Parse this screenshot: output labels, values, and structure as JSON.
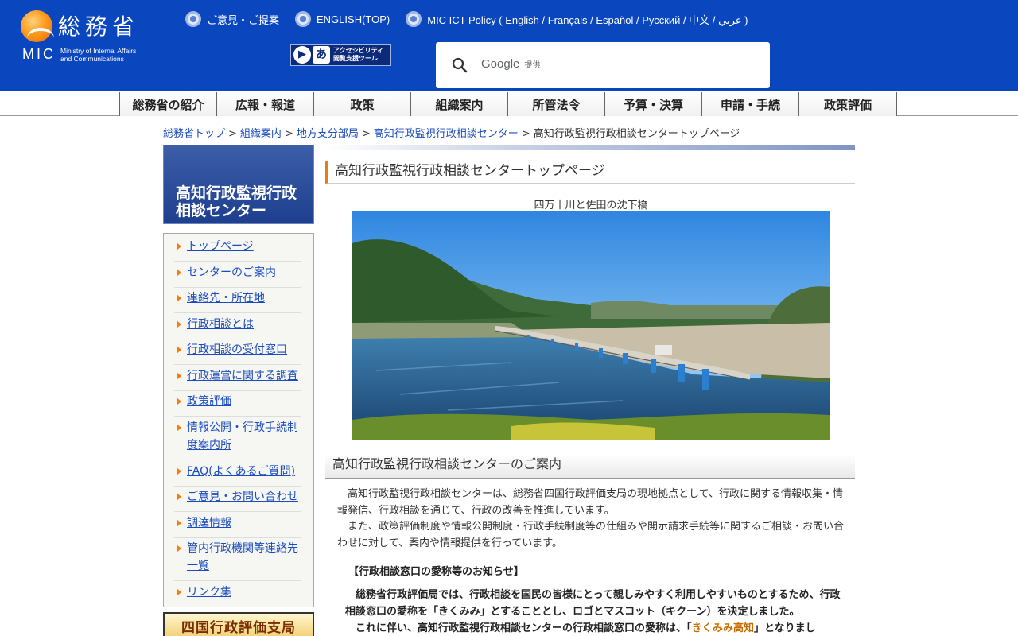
{
  "header": {
    "logo_kanji": "総務省",
    "logo_abbr": "MIC",
    "logo_english_1": "Ministry of Internal Affairs",
    "logo_english_2": "and Communications",
    "top_links": [
      {
        "label": "ご意見・ご提案"
      },
      {
        "label": "ENGLISH(TOP)"
      },
      {
        "label": "MIC ICT Policy ( English / Français / Español / Русский / 中文 / عربي )"
      }
    ],
    "accessibility_tool_label_1": "アクセシビリティ",
    "accessibility_tool_label_2": "閲覧支援ツール",
    "search": {
      "brand": "Google",
      "suffix": "提供"
    }
  },
  "global_nav": [
    {
      "label": "総務省の紹介"
    },
    {
      "label": "広報・報道"
    },
    {
      "label": "政策"
    },
    {
      "label": "組織案内"
    },
    {
      "label": "所管法令"
    },
    {
      "label": "予算・決算"
    },
    {
      "label": "申請・手続"
    },
    {
      "label": "政策評価"
    }
  ],
  "breadcrumb": {
    "links": [
      "総務省トップ",
      "組織案内",
      "地方支分部局",
      "高知行政監視行政相談センター"
    ],
    "separator": ">",
    "current": "高知行政監視行政相談センタートップページ"
  },
  "sidebar": {
    "title_line1": "高知行政監視行政",
    "title_line2": "相談センター",
    "items": [
      {
        "label": "トップページ"
      },
      {
        "label": "センターのご案内"
      },
      {
        "label": "連絡先・所在地"
      },
      {
        "label": "行政相談とは"
      },
      {
        "label": "行政相談の受付窓口"
      },
      {
        "label": "行政運営に関する調査"
      },
      {
        "label": "政策評価"
      },
      {
        "label": "情報公開・行政手続制度案内所"
      },
      {
        "label": "FAQ(よくあるご質問)"
      },
      {
        "label": "ご意見・お問い合わせ"
      },
      {
        "label": "調達情報"
      },
      {
        "label": "管内行政機関等連絡先一覧"
      },
      {
        "label": "リンク集"
      }
    ],
    "banner": "四国行政評価支局"
  },
  "main": {
    "page_title": "高知行政監視行政相談センタートップページ",
    "photo_caption": "四万十川と佐田の沈下橋",
    "section_title": "高知行政監視行政相談センターのご案内",
    "para1": "高知行政監視行政相談センターは、総務省四国行政評価支局の現地拠点として、行政に関する情報収集・情報発信、行政相談を通じて、行政の改善を推進しています。",
    "para2": "また、政策評価制度や情報公開制度・行政手続制度等の仕組みや開示請求手続等に関するご相談・お問い合わせに対して、案内や情報提供を行っています。",
    "notice_head": "【行政相談窓口の愛称等のお知らせ】",
    "notice_para1": "総務省行政評価局では、行政相談を国民の皆様にとって親しみやすく利用しやすいものとするため、行政相談窓口の愛称を「きくみみ」とすることとし、ロゴとマスコット（キクーン）を決定しました。",
    "notice_para2_pre": "これに伴い、高知行政監視行政相談センターの行政相談窓口の愛称は、「",
    "notice_para2_highlight": "きくみみ高知",
    "notice_para2_post": "」となりまし"
  },
  "colors": {
    "header_bg": "#0a46bd",
    "link": "#1a4bbf",
    "accent_orange": "#e87c10",
    "sidebar_title_bg": "#1e3f8e"
  }
}
